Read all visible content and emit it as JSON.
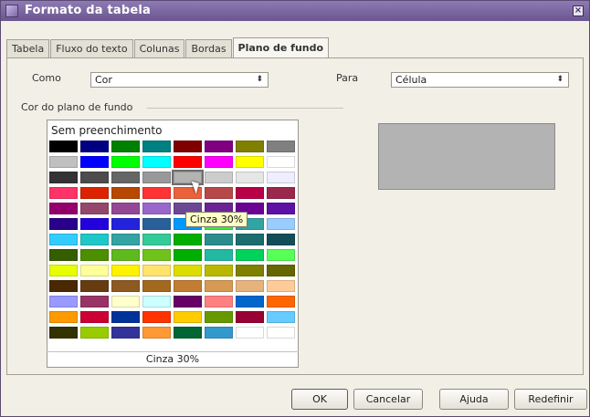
{
  "window": {
    "title": "Formato da tabela"
  },
  "tabs": [
    {
      "label": "Tabela",
      "active": false
    },
    {
      "label": "Fluxo do texto",
      "active": false
    },
    {
      "label": "Colunas",
      "active": false
    },
    {
      "label": "Bordas",
      "active": false
    },
    {
      "label": "Plano de fundo",
      "active": true
    }
  ],
  "fields": {
    "como_label": "Como",
    "como_value": "Cor",
    "para_label": "Para",
    "para_value": "Célula"
  },
  "background": {
    "section_label": "Cor do plano de fundo",
    "no_fill": "Sem preenchimento",
    "tooltip": "Cinza 30%",
    "selected_name": "Cinza 30%",
    "preview_color": "#b3b3b3"
  },
  "palette": [
    [
      "#000000",
      "#000080",
      "#008000",
      "#008080",
      "#800000",
      "#800080",
      "#808000",
      "#808080"
    ],
    [
      "#c0c0c0",
      "#0000ff",
      "#00ff00",
      "#00ffff",
      "#ff0000",
      "#ff00ff",
      "#ffff00",
      "#ffffff"
    ],
    [
      "#333333",
      "#4c4c4c",
      "#666666",
      "#999999",
      "#b3b3b3",
      "#cccccc",
      "#e6e6e6",
      "#eeeeff"
    ],
    [
      "#ff3366",
      "#dc2300",
      "#b84700",
      "#ff3333",
      "#eb613d",
      "#b84747",
      "#b80047",
      "#99284c"
    ],
    [
      "#94006b",
      "#94476b",
      "#944794",
      "#9966cc",
      "#6b4794",
      "#6b2394",
      "#6b0094",
      "#5e11a6"
    ],
    [
      "#28008a",
      "#2300dc",
      "#2323dc",
      "#2a6099",
      "#0099ff",
      "#3deb3d",
      "#33a3a3",
      "#99ccff"
    ],
    [
      "#33ccff",
      "#1ec8c8",
      "#33a3a3",
      "#33cc99",
      "#00ae00",
      "#2a8c8c",
      "#1c6e6e",
      "#124e57"
    ],
    [
      "#355e00",
      "#4c8f00",
      "#5eb91e",
      "#6fc31c",
      "#00ae00",
      "#23b8a2",
      "#00d25a",
      "#57ff57"
    ],
    [
      "#e6ff00",
      "#ffff99",
      "#fff200",
      "#ffe36b",
      "#dcdc00",
      "#b8b800",
      "#808000",
      "#666600"
    ],
    [
      "#4a2800",
      "#683c11",
      "#8d5a22",
      "#a2691f",
      "#c27d33",
      "#d69a52",
      "#e6b37d",
      "#ffcc99"
    ],
    [
      "#9999ff",
      "#993366",
      "#ffffcc",
      "#ccffff",
      "#660066",
      "#ff8080",
      "#0066cc",
      "#ff6600"
    ],
    [
      "#ff9900",
      "#cc0033",
      "#003399",
      "#ff3300",
      "#ffcc00",
      "#669900",
      "#990033",
      "#66ccff"
    ],
    [
      "#333300",
      "#99cc00",
      "#333399",
      "#ff9933",
      "#006633",
      "#3399cc",
      "#ffffff",
      "#ffffff"
    ]
  ],
  "buttons": {
    "ok": "OK",
    "cancel": "Cancelar",
    "help": "Ajuda",
    "reset": "Redefinir"
  }
}
